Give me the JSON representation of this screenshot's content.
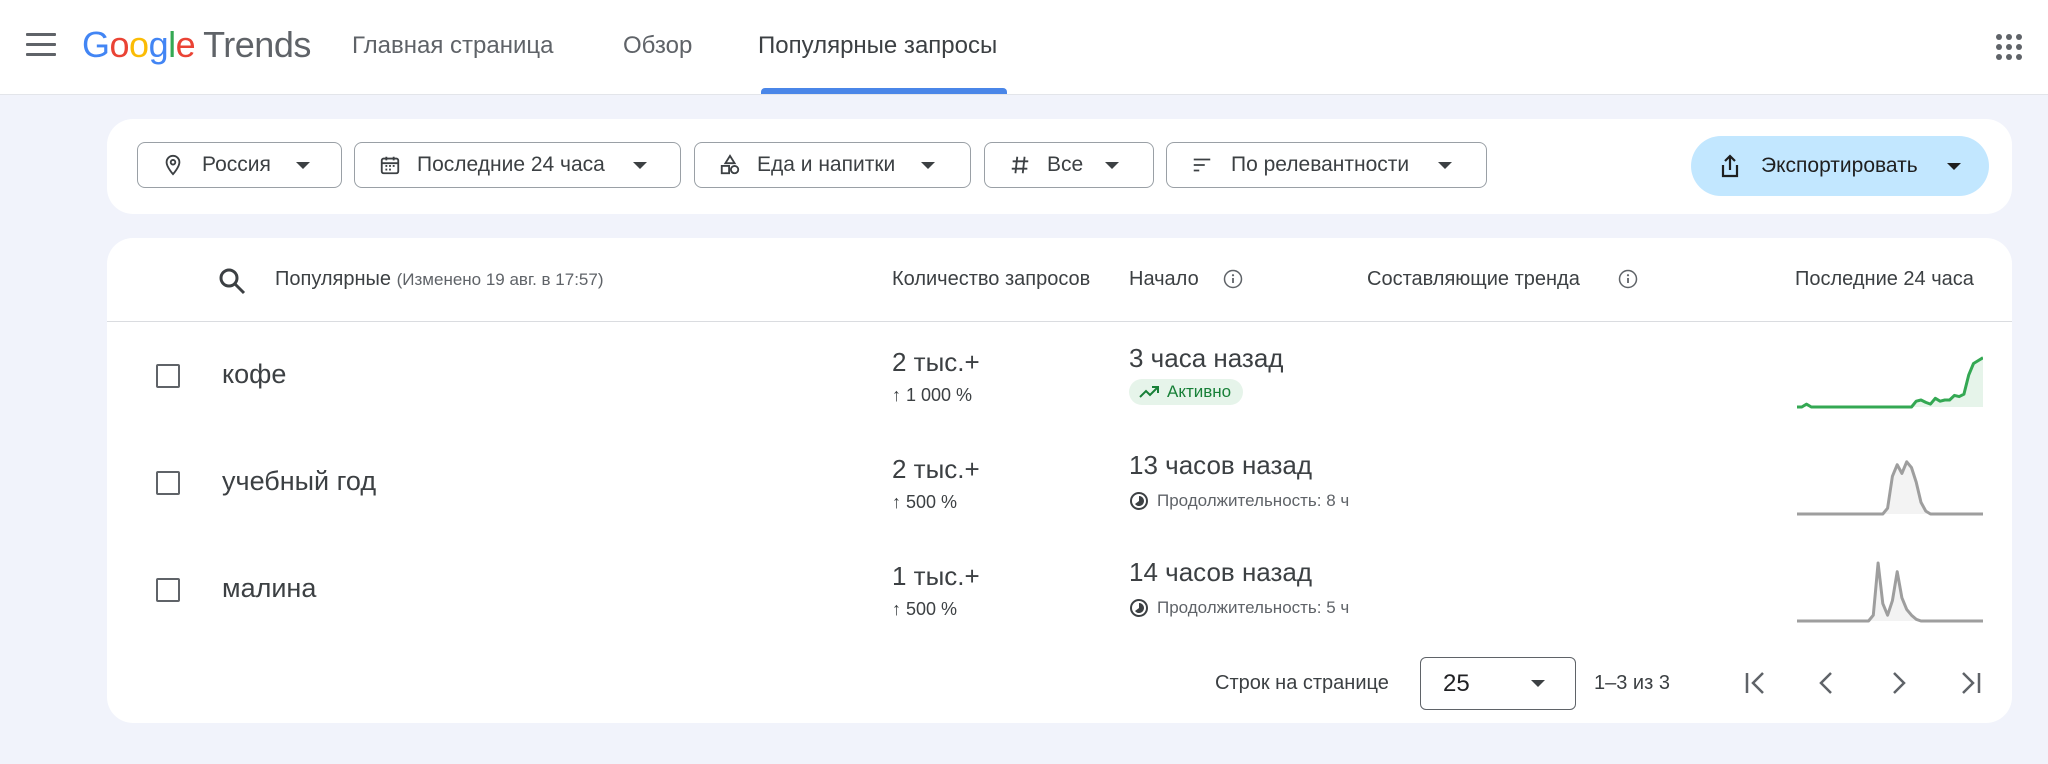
{
  "header": {
    "logo_google": [
      "G",
      "o",
      "o",
      "g",
      "l",
      "e"
    ],
    "logo_product": "Trends",
    "tabs": [
      {
        "label": "Главная страница"
      },
      {
        "label": "Обзор"
      },
      {
        "label": "Популярные запросы"
      }
    ],
    "active_tab": "Популярные запросы"
  },
  "filters": {
    "region": "Россия",
    "period": "Последние 24 часа",
    "category": "Еда и напитки",
    "trend_status": "Все",
    "sort": "По релевантности",
    "export_label": "Экспортировать"
  },
  "table": {
    "columns": {
      "trends": "Популярные",
      "updated": "(Изменено 19 авг. в 17:57)",
      "volume": "Количество запросов",
      "started": "Начало",
      "breakdown": "Составляющие тренда",
      "last24": "Последние 24 часа"
    },
    "rows": [
      {
        "term": "кофе",
        "volume": "2 тыс.+",
        "growth": "↑ 1 000 %",
        "started": "3 часа назад",
        "status": "Активно",
        "spark_color": "#34a853",
        "spark": [
          0,
          0,
          0.05,
          0,
          0,
          0,
          0,
          0,
          0,
          0,
          0,
          0,
          0,
          0,
          0,
          0,
          0,
          0,
          0,
          0,
          0,
          0,
          0,
          0,
          0,
          0.1,
          0.12,
          0.08,
          0.05,
          0.15,
          0.1,
          0.12,
          0.12,
          0.2,
          0.18,
          0.22,
          0.55,
          0.75,
          0.8,
          0.85
        ]
      },
      {
        "term": "учебный год",
        "volume": "2 тыс.+",
        "growth": "↑ 500 %",
        "started": "13 часов назад",
        "duration": "Продолжительность: 8 ч",
        "spark_color": "#9e9e9e",
        "spark": [
          0,
          0,
          0,
          0,
          0,
          0,
          0,
          0,
          0,
          0,
          0,
          0,
          0,
          0,
          0,
          0,
          0,
          0,
          0,
          0.1,
          0.65,
          0.85,
          0.7,
          0.9,
          0.8,
          0.55,
          0.2,
          0.05,
          0,
          0,
          0,
          0,
          0,
          0,
          0,
          0,
          0,
          0,
          0,
          0
        ]
      },
      {
        "term": "малина",
        "volume": "1 тыс.+",
        "growth": "↑ 500 %",
        "started": "14 часов назад",
        "duration": "Продолжительность: 5 ч",
        "spark_color": "#9e9e9e",
        "spark": [
          0,
          0,
          0,
          0,
          0,
          0,
          0,
          0,
          0,
          0,
          0,
          0,
          0,
          0,
          0,
          0,
          0.1,
          1.0,
          0.3,
          0.1,
          0.35,
          0.85,
          0.4,
          0.2,
          0.1,
          0.03,
          0,
          0,
          0,
          0,
          0,
          0,
          0,
          0,
          0,
          0,
          0,
          0,
          0,
          0
        ]
      }
    ]
  },
  "pagination": {
    "rows_per_page_label": "Строк на странице",
    "rows_per_page": "25",
    "range": "1–3 из 3"
  },
  "colors": {
    "accent": "#4a86e8",
    "export_bg": "#c2e7ff",
    "active_green": "#188038"
  }
}
